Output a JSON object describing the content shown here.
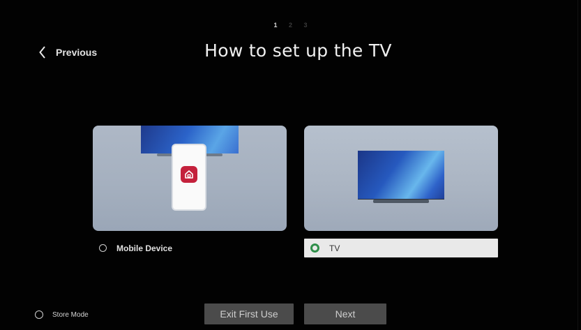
{
  "steps": [
    "1",
    "2",
    "3"
  ],
  "active_step": 0,
  "header": {
    "previous_label": "Previous",
    "title": "How to set up the TV"
  },
  "options": [
    {
      "id": "mobile",
      "label": "Mobile Device",
      "selected": false
    },
    {
      "id": "tv",
      "label": "TV",
      "selected": true
    }
  ],
  "footer": {
    "store_mode_label": "Store Mode",
    "exit_label": "Exit First Use",
    "next_label": "Next"
  },
  "icons": {
    "previous": "chevron-left-icon",
    "app": "home-app-icon"
  },
  "colors": {
    "background": "#000000",
    "selected_radio": "#2f8f4a",
    "app_icon": "#c4213c",
    "button": "#4b4b4b"
  }
}
